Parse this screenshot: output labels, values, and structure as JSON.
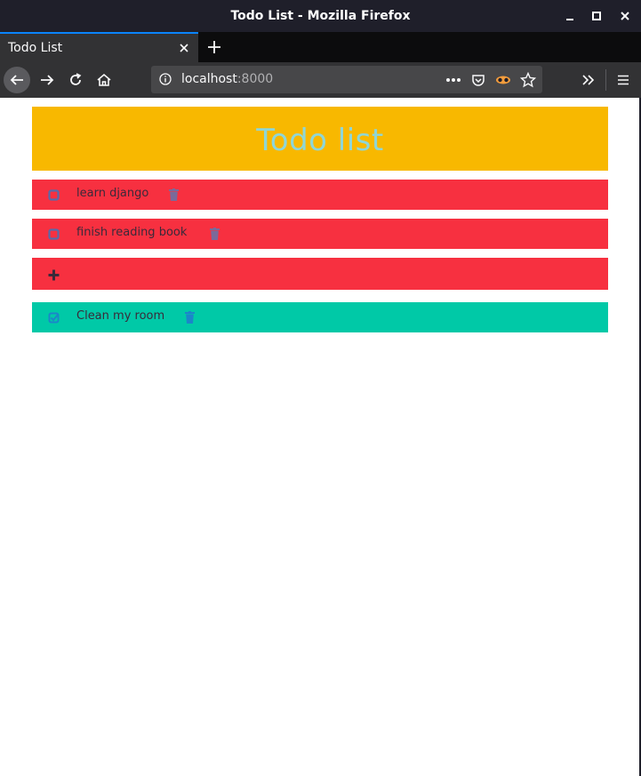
{
  "window": {
    "title": "Todo List - Mozilla Firefox"
  },
  "tabs": [
    {
      "label": "Todo List"
    }
  ],
  "urlbar": {
    "host": "localhost",
    "port": ":8000"
  },
  "app": {
    "title": "Todo list",
    "add_icon": "plus-icon"
  },
  "todos": [
    {
      "text": "learn django",
      "completed": false
    },
    {
      "text": "finish reading book",
      "completed": false
    },
    {
      "text": "Clean my room",
      "completed": true
    }
  ],
  "colors": {
    "header_bg": "#f8b800",
    "header_text": "#8fd6d6",
    "pending_bg": "#f73040",
    "done_bg": "#00c9a7",
    "icon_pending": "#5a6aa8",
    "icon_done": "#1b86c9"
  }
}
